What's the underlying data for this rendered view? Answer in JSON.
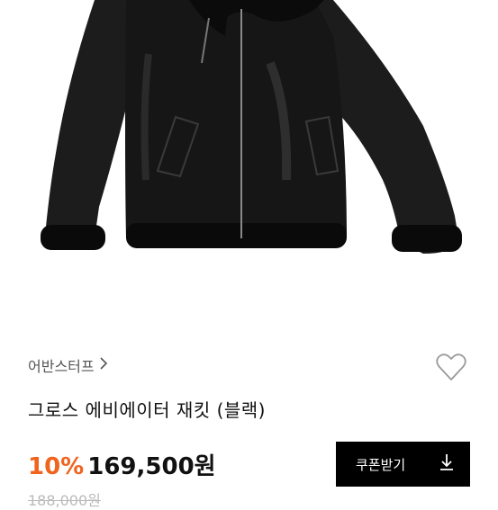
{
  "product": {
    "brand": "어반스터프",
    "title": "그로스 에비에이터 재킷 (블랙)",
    "discount": "10%",
    "price": "169,500원",
    "original_price": "188,000원",
    "image_alt": "black shearling aviator jacket"
  },
  "actions": {
    "coupon_label": "쿠폰받기"
  },
  "icons": {
    "brand_chevron": "chevron-right-icon",
    "wishlist": "heart-outline-icon",
    "coupon": "download-icon"
  },
  "colors": {
    "accent": "#f0641e",
    "button_bg": "#000000",
    "text": "#111111",
    "muted": "#555555",
    "strike": "#bbbbbb"
  }
}
